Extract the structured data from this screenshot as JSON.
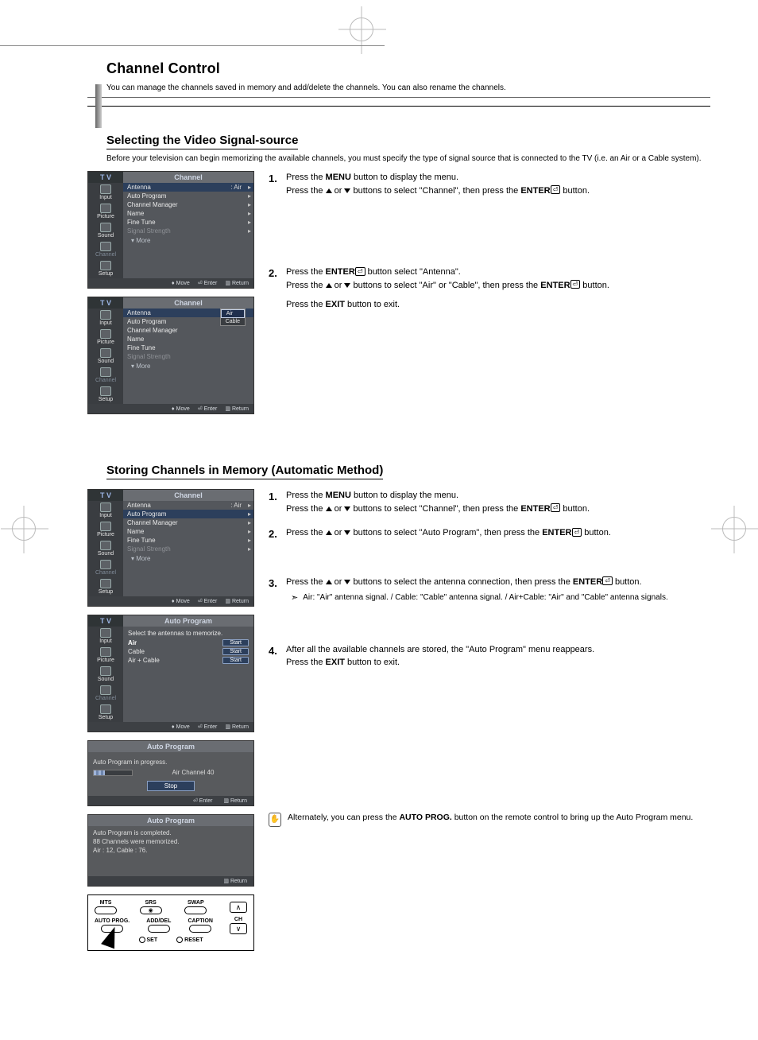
{
  "page": {
    "title": "Channel Control",
    "note_line": "You can manage the channels saved in memory and add/delete the channels. You can also rename the channels.",
    "divider_icon_note": "Press the ▲ or ▼ button to select \"Channel\", then press the ENTER button."
  },
  "section_a": {
    "heading": "Selecting the Video Signal-source",
    "note": "Before your television can begin memorizing the available channels, you must specify the type of signal source that is connected to the TV (i.e. an Air or a Cable system).",
    "steps": {
      "s1": {
        "num": "1.",
        "a": "Press the ",
        "menu": "MENU",
        "b": " button to display the menu.",
        "c": "Press the ",
        "d": " or ",
        "e": " buttons to select \"Channel\", then press the ",
        "enter": "ENTER",
        "f": " button."
      },
      "s2": {
        "num": "2.",
        "a": "Press the ",
        "enter": "ENTER",
        "b": " button select \"Antenna\".",
        "c": "Press the ",
        "d": " or ",
        "e": " buttons to select \"Air\" or \"Cable\", then press the ",
        "f": " button.",
        "g": "Press the ",
        "exit": "EXIT",
        "h": " button to exit."
      }
    }
  },
  "section_b": {
    "heading": "Storing Channels in Memory (Automatic Method)",
    "steps": {
      "s1": {
        "num": "1.",
        "a": "Press the ",
        "menu": "MENU",
        "b": " button to display the menu.",
        "c": "Press the ",
        "d": " or ",
        "e": " buttons to select \"Channel\", then press the ",
        "enter": "ENTER",
        "f": " button."
      },
      "s2": {
        "num": "2.",
        "a": "Press the ",
        "b": " or ",
        "c": " buttons to select \"Auto Program\", then press the ",
        "enter": "ENTER",
        "d": " button."
      },
      "s3": {
        "num": "3.",
        "a": "Press the ",
        "b": " or ",
        "c": " buttons to select the antenna connection, then press the ",
        "enter": "ENTER",
        "d": " button.",
        "note": "Air: \"Air\" antenna signal. / Cable: \"Cable\" antenna signal. / Air+Cable: \"Air\" and \"Cable\" antenna signals."
      },
      "s4": {
        "num": "4.",
        "a": "After all the available channels are stored, the \"Auto Program\" menu reappears.",
        "b": "Press the ",
        "exit": "EXIT",
        "c": " button to exit."
      }
    },
    "tip": {
      "a": "Alternately, you can press the ",
      "autoprog": "AUTO PROG.",
      "b": " button on the remote control to bring up the Auto Program menu."
    }
  },
  "osd_channel": {
    "tv": "T V",
    "title": "Channel",
    "side": [
      "Input",
      "Picture",
      "Sound",
      "Channel",
      "Setup"
    ],
    "rows": [
      {
        "label": "Antenna",
        "val": ": Air",
        "sel": true
      },
      {
        "label": "Auto Program"
      },
      {
        "label": "Channel Manager"
      },
      {
        "label": "Name"
      },
      {
        "label": "Fine Tune"
      },
      {
        "label": "Signal Strength",
        "dis": true
      }
    ],
    "more": "▾  More",
    "ftr": {
      "move": "Move",
      "enter": "Enter",
      "ret": "Return"
    }
  },
  "osd_antenna": {
    "tv": "T V",
    "title": "Channel",
    "rows": [
      {
        "label": "Antenna",
        "val": ": ",
        "opts": [
          "Air",
          "Cable"
        ],
        "selopt": "Air"
      },
      {
        "label": "Auto Program"
      },
      {
        "label": "Channel Manager"
      },
      {
        "label": "Name"
      },
      {
        "label": "Fine Tune"
      },
      {
        "label": "Signal Strength",
        "dis": true
      }
    ],
    "more": "▾  More"
  },
  "osd_channel_b": {
    "rows": [
      {
        "label": "Antenna",
        "val": ": Air"
      },
      {
        "label": "Auto Program",
        "sel": true
      },
      {
        "label": "Channel Manager"
      },
      {
        "label": "Name"
      },
      {
        "label": "Fine Tune"
      },
      {
        "label": "Signal Strength",
        "dis": true
      }
    ]
  },
  "osd_autoprog": {
    "title": "Auto Program",
    "prompt": "Select the antennas to memorize.",
    "rows": [
      {
        "label": "Air",
        "sel": true,
        "btn": "Start"
      },
      {
        "label": "Cable",
        "btn": "Start"
      },
      {
        "label": "Air + Cable",
        "btn": "Start"
      }
    ]
  },
  "osd_progress": {
    "title": "Auto Program",
    "line": "Auto Program in progress.",
    "status": "Air Channel  40",
    "stop": "Stop",
    "enter": "Enter",
    "ret": "Return"
  },
  "osd_complete": {
    "title": "Auto Program",
    "l1": "Auto Program is completed.",
    "l2": "88 Channels were memorized.",
    "l3": "Air : 12, Cable : 76.",
    "ret": "Return"
  },
  "remote": {
    "mts": "MTS",
    "srs": "SRS",
    "swap": "SWAP",
    "autoprog": "AUTO PROG.",
    "adddel": "ADD/DEL",
    "caption": "CAPTION",
    "ch": "CH",
    "set": "SET",
    "reset": "RESET"
  }
}
